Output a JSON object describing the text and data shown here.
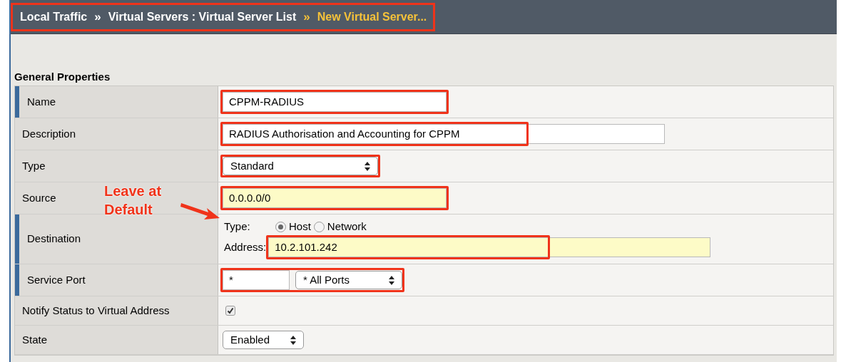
{
  "breadcrumb": [
    {
      "kind": "crumb",
      "label": "Local Traffic",
      "current": false
    },
    {
      "kind": "separator",
      "label": "»",
      "current": false
    },
    {
      "kind": "crumb",
      "label": "Virtual Servers : Virtual Server List",
      "current": false
    },
    {
      "kind": "separator",
      "label": "»",
      "current": true
    },
    {
      "kind": "crumb",
      "label": "New Virtual Server...",
      "current": true
    }
  ],
  "breadcrumb_highlighted": true,
  "section_title": "General Properties",
  "callout": {
    "text": "Leave at Default"
  },
  "rows": [
    {
      "label": "Name",
      "required": true,
      "kind": "short-text",
      "value": "CPPM-RADIUS",
      "yellow": false,
      "highlighted": true
    },
    {
      "label": "Description",
      "required": false,
      "kind": "long-text",
      "value": "RADIUS Authorisation and Accounting for CPPM",
      "yellow": false,
      "highlighted": true
    },
    {
      "label": "Type",
      "required": false,
      "kind": "select",
      "value": "Standard",
      "highlighted": true
    },
    {
      "label": "Source",
      "required": false,
      "kind": "short-text",
      "value": "0.0.0.0/0",
      "yellow": true,
      "highlighted": true
    },
    {
      "label": "Destination",
      "required": true,
      "kind": "destination",
      "type_label": "Type:",
      "options": [
        {
          "label": "Host",
          "selected": true
        },
        {
          "label": "Network",
          "selected": false
        }
      ],
      "address_label": "Address:",
      "value": "10.2.101.242",
      "yellow": true,
      "highlighted": true
    },
    {
      "label": "Service Port",
      "required": true,
      "kind": "port",
      "port": "*",
      "value": "* All Ports",
      "highlighted": true
    },
    {
      "label": "Notify Status to Virtual Address",
      "required": false,
      "kind": "checkbox",
      "checked": true
    },
    {
      "label": "State",
      "required": false,
      "kind": "small-select",
      "value": "Enabled",
      "highlighted": false
    }
  ]
}
